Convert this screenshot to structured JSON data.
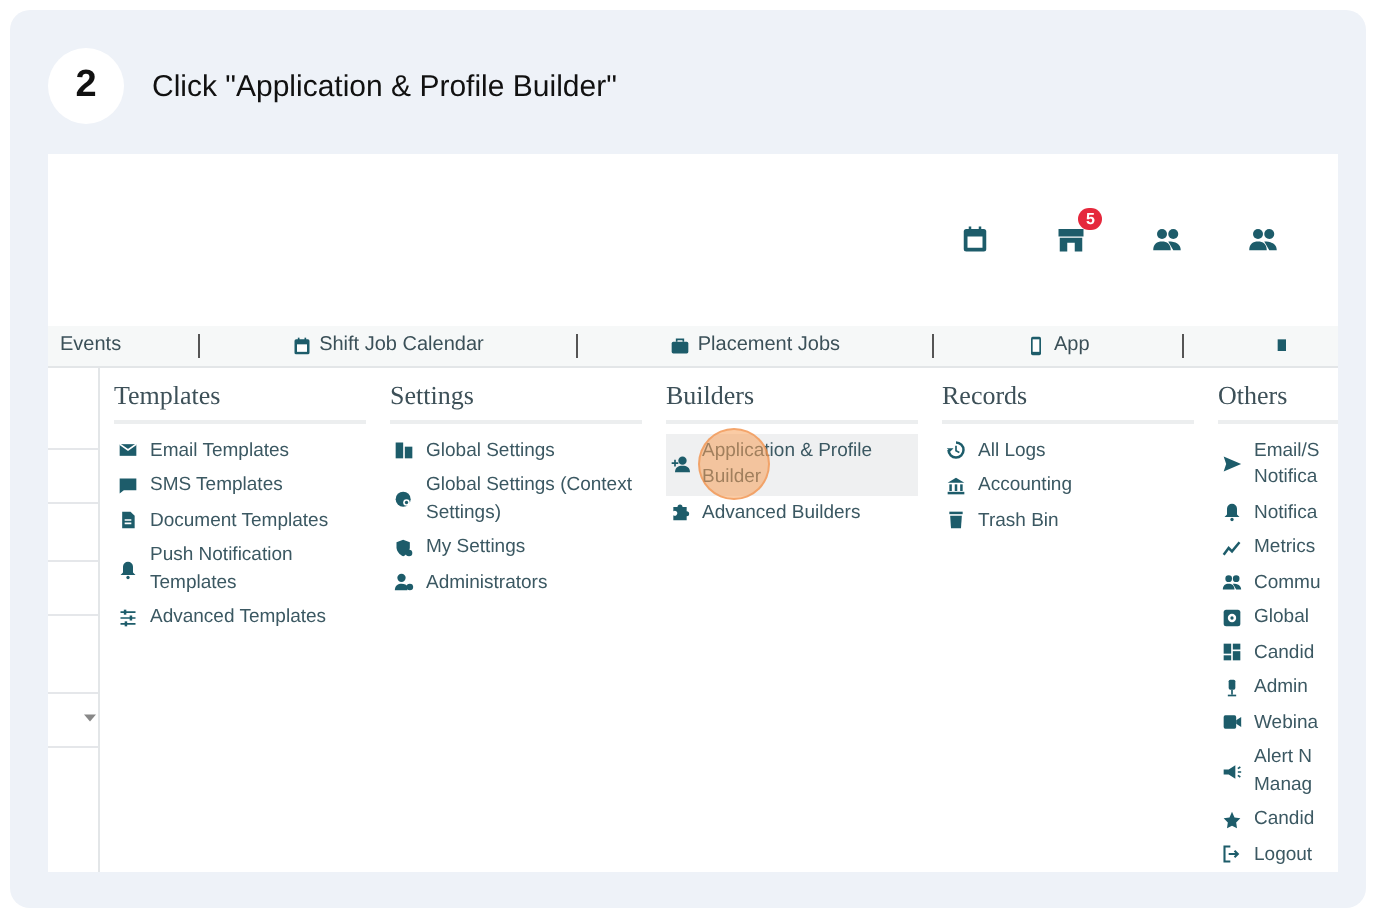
{
  "step": {
    "number": "2",
    "instruction": "Click \"Application & Profile Builder\""
  },
  "store_badge": "5",
  "nav": [
    "Events",
    "Shift Job Calendar",
    "Placement Jobs",
    "App"
  ],
  "menu": [
    {
      "heading": "Templates",
      "items": [
        {
          "label": "Email Templates",
          "selected": false
        },
        {
          "label": "SMS Templates",
          "selected": false
        },
        {
          "label": "Document Templates",
          "selected": false
        },
        {
          "label": "Push Notification Templates",
          "selected": false
        },
        {
          "label": "Advanced Templates",
          "selected": false
        }
      ]
    },
    {
      "heading": "Settings",
      "items": [
        {
          "label": "Global Settings",
          "selected": false
        },
        {
          "label": "Global Settings (Context Settings)",
          "selected": false
        },
        {
          "label": "My Settings",
          "selected": false
        },
        {
          "label": "Administrators",
          "selected": false
        }
      ]
    },
    {
      "heading": "Builders",
      "items": [
        {
          "label": "Application & Profile Builder",
          "selected": true
        },
        {
          "label": "Advanced Builders",
          "selected": false
        }
      ]
    },
    {
      "heading": "Records",
      "items": [
        {
          "label": "All Logs",
          "selected": false
        },
        {
          "label": "Accounting",
          "selected": false
        },
        {
          "label": "Trash Bin",
          "selected": false
        }
      ]
    },
    {
      "heading": "Others",
      "items": [
        {
          "label": "Email/S Notifica",
          "selected": false
        },
        {
          "label": "Notifica",
          "selected": false
        },
        {
          "label": "Metrics",
          "selected": false
        },
        {
          "label": "Commu",
          "selected": false
        },
        {
          "label": "Global",
          "selected": false
        },
        {
          "label": "Candid",
          "selected": false
        },
        {
          "label": "Admin",
          "selected": false
        },
        {
          "label": "Webina",
          "selected": false
        },
        {
          "label": "Alert N Manag",
          "selected": false
        },
        {
          "label": "Candid",
          "selected": false
        },
        {
          "label": "Logout",
          "selected": false
        }
      ]
    }
  ]
}
